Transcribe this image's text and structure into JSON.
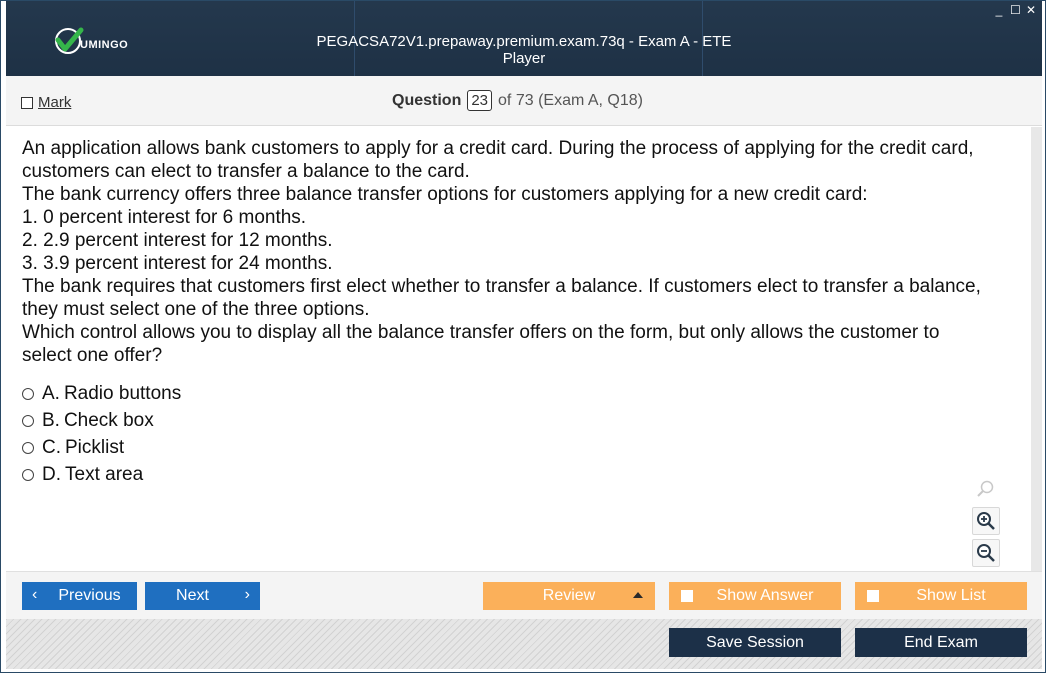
{
  "window": {
    "title": "PEGACSA72V1.prepaway.premium.exam.73q - Exam A - ETE Player",
    "logo_text": "UMINGO",
    "controls": [
      "_",
      "☐",
      "✕"
    ]
  },
  "header": {
    "mark_label": "Mark",
    "question_label": "Question",
    "question_number": "23",
    "question_of": "of 73 (Exam A, Q18)"
  },
  "question": {
    "lines": [
      "An application allows bank customers to apply for a credit card. During the process of applying for the credit card, customers can elect to transfer a balance to the card.",
      "The bank currency offers three balance transfer options for customers applying for a new credit card:",
      "1. 0 percent interest for 6 months.",
      "2. 2.9 percent interest for 12 months.",
      "3. 3.9 percent interest for 24 months.",
      "The bank requires that customers first elect whether to transfer a balance. If customers elect to transfer a balance, they must select one of the three options.",
      "Which control allows you to display all the balance transfer offers on the form, but only allows the customer to select one offer?"
    ],
    "options": [
      {
        "letter": "A.",
        "text": "Radio buttons"
      },
      {
        "letter": "B.",
        "text": "Check box"
      },
      {
        "letter": "C.",
        "text": "Picklist"
      },
      {
        "letter": "D.",
        "text": "Text area"
      }
    ]
  },
  "toolbar": {
    "previous_label": "Previous",
    "next_label": "Next",
    "review_label": "Review",
    "show_answer_label": "Show Answer",
    "show_list_label": "Show List",
    "save_session_label": "Save Session",
    "end_exam_label": "End Exam"
  },
  "icons": {
    "logo": "checkmark-logo-icon",
    "search": "magnifier-icon",
    "zoom_in": "zoom-in-icon",
    "zoom_out": "zoom-out-icon"
  },
  "colors": {
    "title_bar": "#1e3145",
    "nav_button": "#1f6fc0",
    "review_button": "#fbb05a",
    "session_button": "#1c3048",
    "logo_green": "#35b54a"
  }
}
